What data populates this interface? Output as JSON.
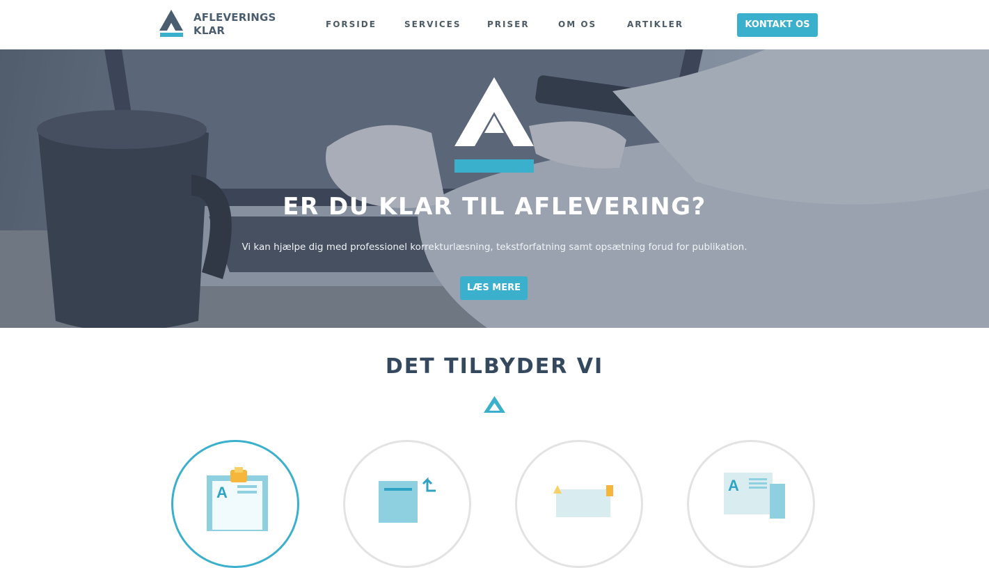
{
  "brand": {
    "line1": "AFLEVERINGS",
    "line2": "KLAR",
    "logo_icon": "triangle-a-logo"
  },
  "nav": {
    "items": [
      {
        "label": "FORSIDE"
      },
      {
        "label": "SERVICES"
      },
      {
        "label": "PRISER"
      },
      {
        "label": "OM OS"
      },
      {
        "label": "ARTIKLER"
      }
    ],
    "cta_label": "KONTAKT OS"
  },
  "hero": {
    "title": "ER DU KLAR TIL AFLEVERING?",
    "subtitle": "Vi kan hjælpe dig med professionel korrekturlæsning, tekstforfatning samt opsætning forud for publikation.",
    "button_label": "LÆS MERE",
    "logo_icon": "triangle-a-logo"
  },
  "services_section": {
    "title": "DET TILBYDER VI",
    "divider_icon": "triangle-icon",
    "items": [
      {
        "icon": "document-clipboard-icon",
        "active": true
      },
      {
        "icon": "document-transfer-icon",
        "active": false
      },
      {
        "icon": "layout-pencil-icon",
        "active": false
      },
      {
        "icon": "newspaper-icon",
        "active": false
      }
    ]
  },
  "colors": {
    "accent": "#3ab0cd",
    "dark_text": "#34495e",
    "nav_text": "#4d5b66"
  }
}
